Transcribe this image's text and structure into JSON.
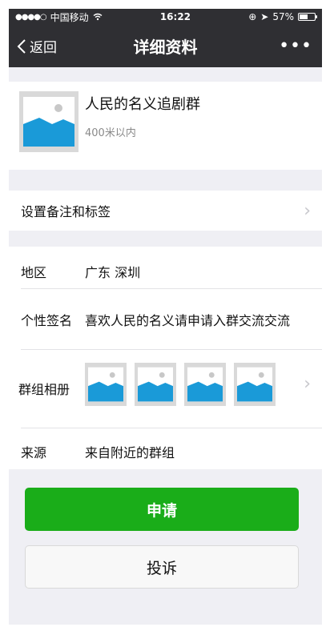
{
  "status_bar": {
    "carrier": "中国移动",
    "time": "16:22",
    "battery": "57%",
    "battery_level": 0.57
  },
  "nav": {
    "back_label": "返回",
    "title": "详细资料",
    "more_label": "•••"
  },
  "profile": {
    "name": "人民的名义追剧群",
    "distance": "400米以内"
  },
  "remark": {
    "label": "设置备注和标签"
  },
  "info": {
    "region_label": "地区",
    "region_value": "广东 深圳",
    "signature_label": "个性签名",
    "signature_value": "喜欢人民的名义请申请入群交流交流",
    "album_label": "群组相册",
    "source_label": "来源",
    "source_value": "来自附近的群组"
  },
  "actions": {
    "apply_label": "申请",
    "report_label": "投诉"
  },
  "colors": {
    "nav_bg": "#2f2f33",
    "primary": "#1aad19",
    "placeholder_blue": "#1a9ad8"
  }
}
